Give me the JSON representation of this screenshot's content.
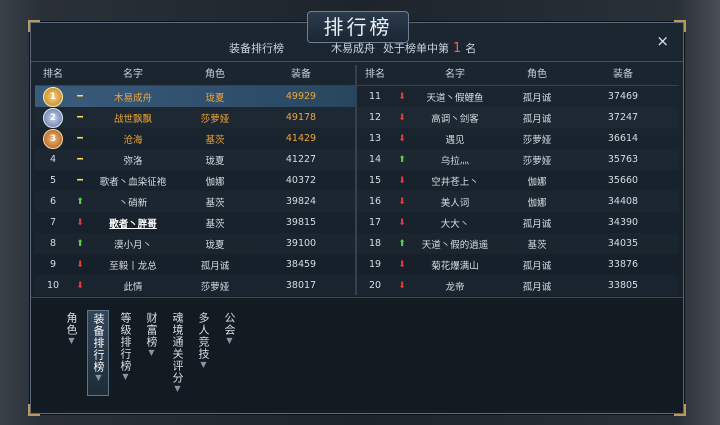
{
  "title": "排行榜",
  "subtitle": {
    "board": "装备排行榜",
    "player": "木易成舟",
    "position_prefix": "处于榜单中第",
    "position": "1",
    "position_suffix": "名"
  },
  "close_label": "×",
  "headers": {
    "rank": "排名",
    "name": "名字",
    "role": "角色",
    "score": "装备"
  },
  "left_rows": [
    {
      "rank": "1",
      "trend": "same",
      "name": "木易成舟",
      "role": "珑夏",
      "score": "49929"
    },
    {
      "rank": "2",
      "trend": "same",
      "name": "战世飘飘",
      "role": "莎萝娅",
      "score": "49178"
    },
    {
      "rank": "3",
      "trend": "same",
      "name": "沧海",
      "role": "基茨",
      "score": "41429"
    },
    {
      "rank": "4",
      "trend": "same",
      "name": "弥洛",
      "role": "珑夏",
      "score": "41227"
    },
    {
      "rank": "5",
      "trend": "same",
      "name": "歌者丶血染征袍",
      "role": "伽娜",
      "score": "40372"
    },
    {
      "rank": "6",
      "trend": "up",
      "name": "丶硝新",
      "role": "基茨",
      "score": "39824"
    },
    {
      "rank": "7",
      "trend": "down",
      "name": "歌者丶胖哥",
      "role": "基茨",
      "score": "39815"
    },
    {
      "rank": "8",
      "trend": "up",
      "name": "漠小月丶",
      "role": "珑夏",
      "score": "39100"
    },
    {
      "rank": "9",
      "trend": "down",
      "name": "至毅丨龙总",
      "role": "孤月诚",
      "score": "38459"
    },
    {
      "rank": "10",
      "trend": "down",
      "name": "此情",
      "role": "莎萝娅",
      "score": "38017"
    }
  ],
  "right_rows": [
    {
      "rank": "11",
      "trend": "down",
      "name": "天道丶假鲤鱼",
      "role": "孤月诚",
      "score": "37469"
    },
    {
      "rank": "12",
      "trend": "down",
      "name": "高调丶剑客",
      "role": "孤月诚",
      "score": "37247"
    },
    {
      "rank": "13",
      "trend": "down",
      "name": "遇见",
      "role": "莎萝娅",
      "score": "36614"
    },
    {
      "rank": "14",
      "trend": "up",
      "name": "乌拉灬",
      "role": "莎萝娅",
      "score": "35763"
    },
    {
      "rank": "15",
      "trend": "down",
      "name": "空井苍上丶",
      "role": "伽娜",
      "score": "35660"
    },
    {
      "rank": "16",
      "trend": "down",
      "name": "美人词",
      "role": "伽娜",
      "score": "34408"
    },
    {
      "rank": "17",
      "trend": "down",
      "name": "大大丶",
      "role": "孤月诚",
      "score": "34390"
    },
    {
      "rank": "18",
      "trend": "up",
      "name": "天道丶假的逍遥",
      "role": "基茨",
      "score": "34035"
    },
    {
      "rank": "19",
      "trend": "down",
      "name": "菊花爆满山",
      "role": "孤月诚",
      "score": "33876"
    },
    {
      "rank": "20",
      "trend": "down",
      "name": "龙帝",
      "role": "孤月诚",
      "score": "33805"
    }
  ],
  "tabs": [
    {
      "label": "角色",
      "active": false
    },
    {
      "label": "装备排行榜",
      "active": true
    },
    {
      "label": "等级排行榜",
      "active": false
    },
    {
      "label": "财富榜",
      "active": false
    },
    {
      "label": "魂境通关评分",
      "active": false
    },
    {
      "label": "多人竞技",
      "active": false
    },
    {
      "label": "公会",
      "active": false
    }
  ],
  "colors": {
    "accent": "#f0a436",
    "rank_highlight": "#ff5a5a",
    "trend_up": "#5fd04a",
    "trend_down": "#e43b3b",
    "trend_same": "#ffd84a"
  }
}
